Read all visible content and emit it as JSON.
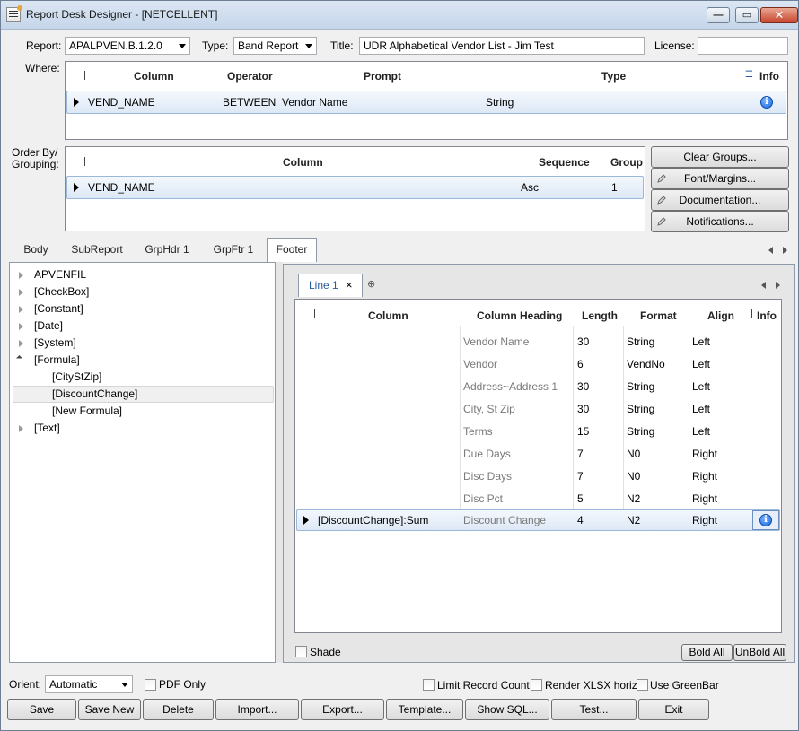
{
  "window": {
    "title": "Report Desk Designer - [NETCELLENT]",
    "minimize_glyph": "—",
    "maximize_glyph": "▭",
    "close_glyph": "✕"
  },
  "header": {
    "report_label": "Report:",
    "report_value": "APALPVEN.B.1.2.0",
    "type_label": "Type:",
    "type_value": "Band Report",
    "title_label": "Title:",
    "title_value": "UDR Alphabetical Vendor List - Jim Test",
    "license_label": "License:",
    "license_value": ""
  },
  "where": {
    "label": "Where:",
    "columns": [
      "Column",
      "Operator",
      "Prompt",
      "Type",
      "Info"
    ],
    "rows": [
      {
        "column": "VEND_NAME",
        "operator": "BETWEEN",
        "prompt": "Vendor Name",
        "type": "String"
      }
    ]
  },
  "order_by": {
    "label_line1": "Order By/",
    "label_line2": "Grouping:",
    "columns": [
      "Column",
      "Sequence",
      "Group"
    ],
    "rows": [
      {
        "column": "VEND_NAME",
        "sequence": "Asc",
        "group": "1"
      }
    ]
  },
  "side_buttons": [
    "Clear Groups...",
    "Font/Margins...",
    "Documentation...",
    "Notifications..."
  ],
  "tabs": [
    "Body",
    "SubReport",
    "GrpHdr 1",
    "GrpFtr 1",
    "Footer"
  ],
  "active_tab": "Footer",
  "tree": [
    {
      "label": "APVENFIL",
      "expander": "closed"
    },
    {
      "label": "[CheckBox]",
      "expander": "closed"
    },
    {
      "label": "[Constant]",
      "expander": "closed"
    },
    {
      "label": "[Date]",
      "expander": "closed"
    },
    {
      "label": "[System]",
      "expander": "closed"
    },
    {
      "label": "[Formula]",
      "expander": "open"
    },
    {
      "label": "[CityStZip]",
      "expander": "none"
    },
    {
      "label": "[DiscountChange]",
      "expander": "none",
      "selected": true
    },
    {
      "label": "[New Formula]",
      "expander": "none"
    },
    {
      "label": "[Text]",
      "expander": "closed"
    }
  ],
  "line_tab": {
    "label": "Line 1",
    "close_glyph": "×",
    "add_glyph": "⊕"
  },
  "line_columns": {
    "headers": [
      "Column",
      "Column Heading",
      "Length",
      "Format",
      "Align",
      "Info"
    ],
    "rows": [
      {
        "column": "",
        "heading": "Vendor Name",
        "length": "30",
        "format": "String",
        "align": "Left"
      },
      {
        "column": "",
        "heading": "Vendor",
        "length": "6",
        "format": "VendNo",
        "align": "Left"
      },
      {
        "column": "",
        "heading": "Address~Address 1",
        "length": "30",
        "format": "String",
        "align": "Left"
      },
      {
        "column": "",
        "heading": "City, St Zip",
        "length": "30",
        "format": "String",
        "align": "Left"
      },
      {
        "column": "",
        "heading": "Terms",
        "length": "15",
        "format": "String",
        "align": "Left"
      },
      {
        "column": "",
        "heading": "Due Days",
        "length": "7",
        "format": "N0",
        "align": "Right"
      },
      {
        "column": "",
        "heading": "Disc Days",
        "length": "7",
        "format": "N0",
        "align": "Right"
      },
      {
        "column": "",
        "heading": "Disc Pct",
        "length": "5",
        "format": "N2",
        "align": "Right"
      },
      {
        "column": "[DiscountChange]:Sum",
        "heading": "Discount Change",
        "length": "4",
        "format": "N2",
        "align": "Right"
      }
    ]
  },
  "shade_label": "Shade",
  "bold_all": "Bold All",
  "unbold_all": "UnBold All",
  "bottom": {
    "orient_label": "Orient:",
    "orient_value": "Automatic",
    "pdf_only": "PDF Only",
    "limit_record_count": "Limit Record Count",
    "render_xlsx": "Render XLSX horiz.",
    "use_greenbar": "Use GreenBar"
  },
  "action_buttons": [
    "Save",
    "Save New",
    "Delete",
    "Import...",
    "Export...",
    "Template...",
    "Show SQL...",
    "Test...",
    "Exit"
  ],
  "colors": {
    "accent": "#2a5aa0",
    "row_highlight": "#dde8f6",
    "info_icon": "#1565d8"
  },
  "icons": {
    "app": "report-designer-icon",
    "info": "info-icon",
    "pencil": "pencil-icon",
    "row": "row-indicator-icon"
  }
}
